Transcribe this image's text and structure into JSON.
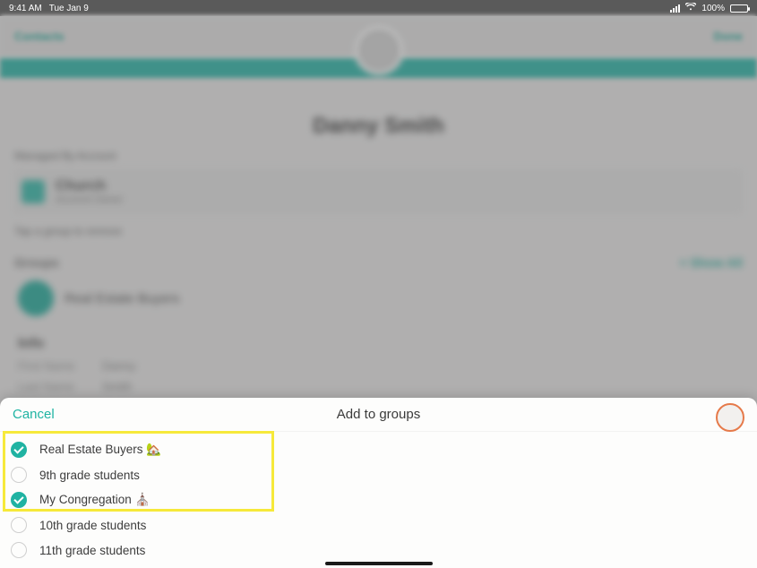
{
  "status": {
    "time": "9:41 AM",
    "date": "Tue Jan 9",
    "battery_pct": "100%"
  },
  "bg": {
    "back_label": "Contacts",
    "done_label": "Done",
    "contact_name": "Danny   Smith",
    "managed_label": "Managed By Account",
    "account_name": "Church",
    "account_sub": "Account Owner",
    "groups_label": "Groups",
    "show_all": "+ Show All",
    "group_name": "Real Estate Buyers",
    "info_title": "Info",
    "rows": [
      {
        "label": "First Name",
        "value": "Danny"
      },
      {
        "label": "Last Name",
        "value": "Smith"
      }
    ]
  },
  "sheet": {
    "cancel": "Cancel",
    "title": "Add to groups",
    "groups": [
      {
        "label": "Real Estate Buyers 🏡",
        "selected": true
      },
      {
        "label": "9th grade students",
        "selected": false
      },
      {
        "label": "My Congregation ⛪",
        "selected": true
      },
      {
        "label": "10th grade students",
        "selected": false
      },
      {
        "label": "11th grade students",
        "selected": false
      }
    ]
  }
}
